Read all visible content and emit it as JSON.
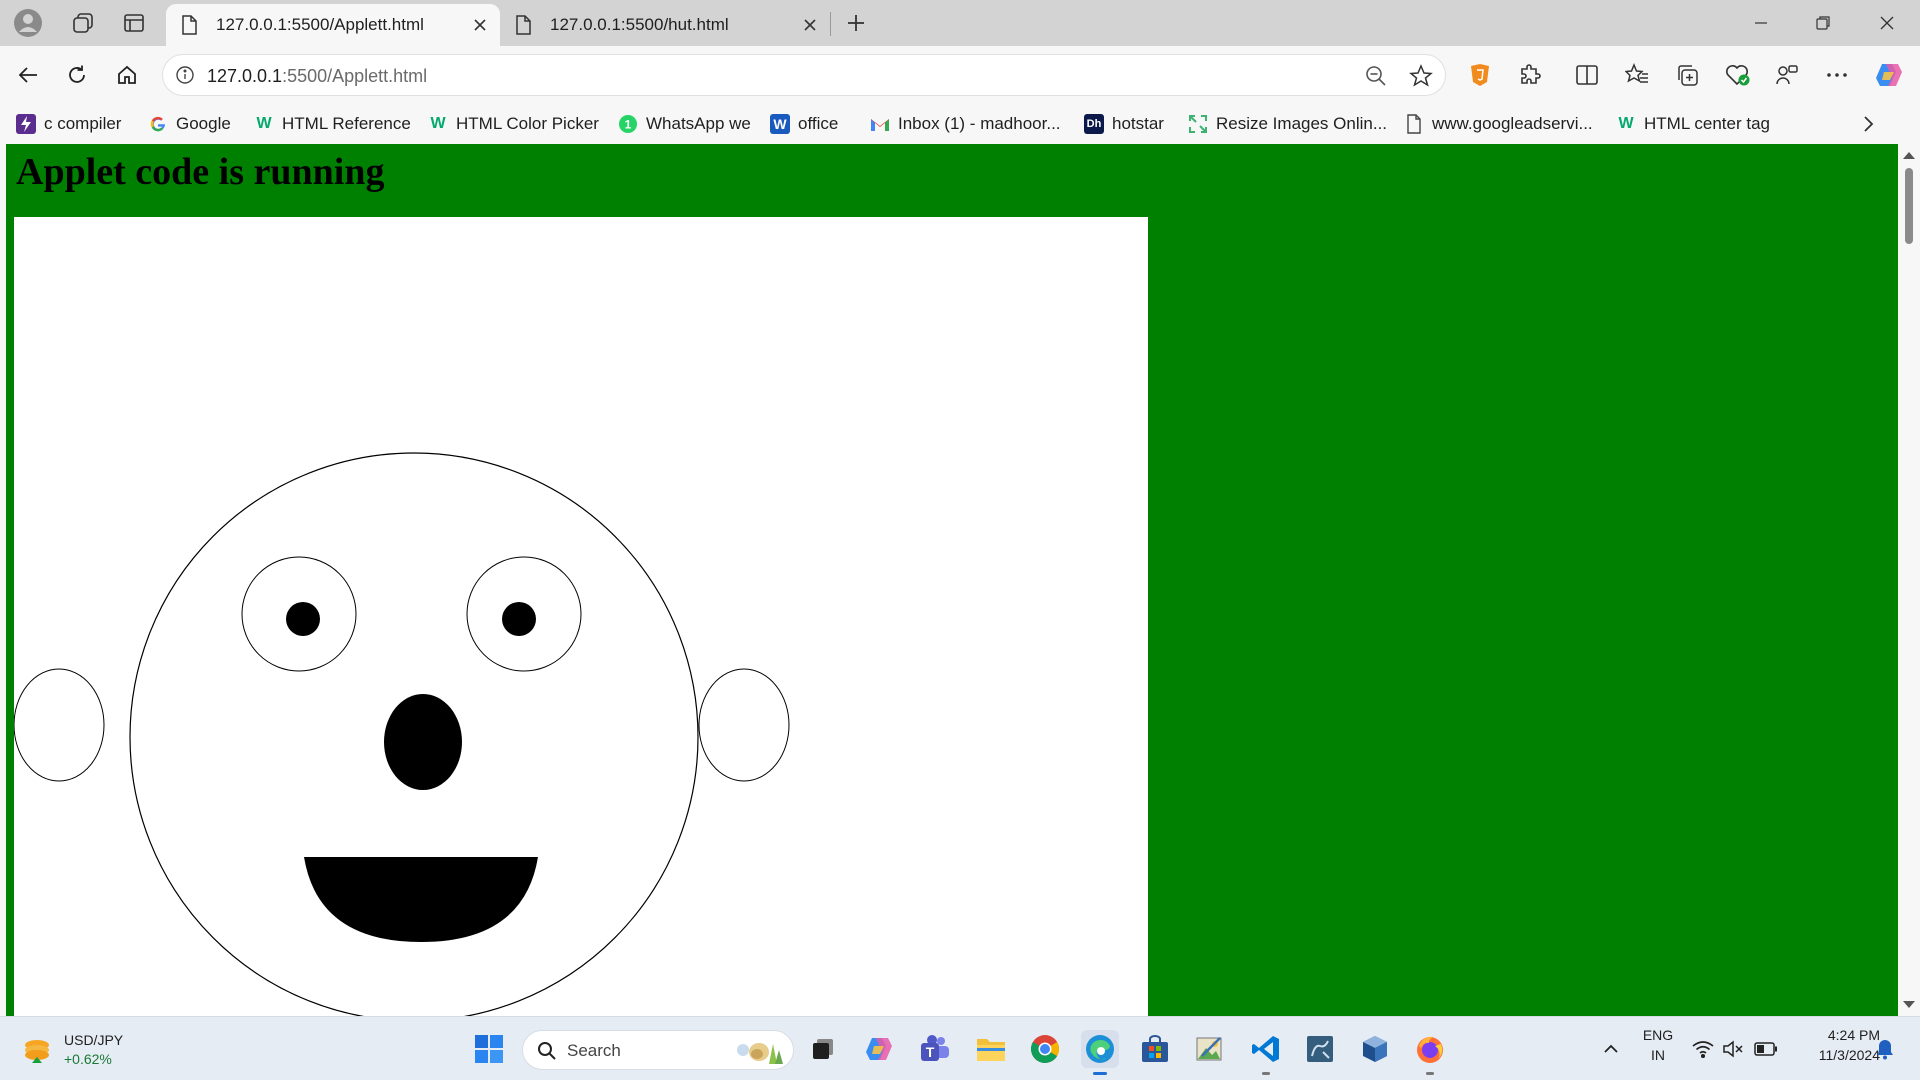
{
  "browser": {
    "tabs": [
      {
        "title": "127.0.0.1:5500/Applett.html",
        "active": true
      },
      {
        "title": "127.0.0.1:5500/hut.html",
        "active": false
      }
    ],
    "address_host": "127.0.0.1",
    "address_path": ":5500/Applett.html",
    "bookmarks": [
      {
        "label": "c compiler",
        "icon": "bolt-icon",
        "color": "#5b2d8e"
      },
      {
        "label": "Google",
        "icon": "google-icon",
        "color": "#4285f4"
      },
      {
        "label": "HTML Reference",
        "icon": "w3schools-icon",
        "color": "#04aa6d"
      },
      {
        "label": "HTML Color Picker",
        "icon": "w3schools-icon",
        "color": "#04aa6d"
      },
      {
        "label": "WhatsApp we",
        "icon": "whatsapp-icon",
        "color": "#25d366"
      },
      {
        "label": "office",
        "icon": "word-icon",
        "color": "#185abd"
      },
      {
        "label": "Inbox (1) - madhoor...",
        "icon": "gmail-icon",
        "color": "#ea4335"
      },
      {
        "label": "hotstar",
        "icon": "hotstar-icon",
        "color": "#0c1a4b"
      },
      {
        "label": "Resize Images Onlin...",
        "icon": "resize-icon",
        "color": "#3cb371"
      },
      {
        "label": "www.googleadservi...",
        "icon": "page-icon",
        "color": "#444444"
      },
      {
        "label": "HTML center tag",
        "icon": "w3schools-icon",
        "color": "#04aa6d"
      }
    ]
  },
  "page": {
    "heading": "Applet code is running",
    "background": "#008000"
  },
  "taskbar": {
    "widget_title": "USD/JPY",
    "widget_change": "+0.62%",
    "search_placeholder": "Search",
    "lang_line1": "ENG",
    "lang_line2": "IN",
    "time": "4:24 PM",
    "date": "11/3/2024"
  }
}
